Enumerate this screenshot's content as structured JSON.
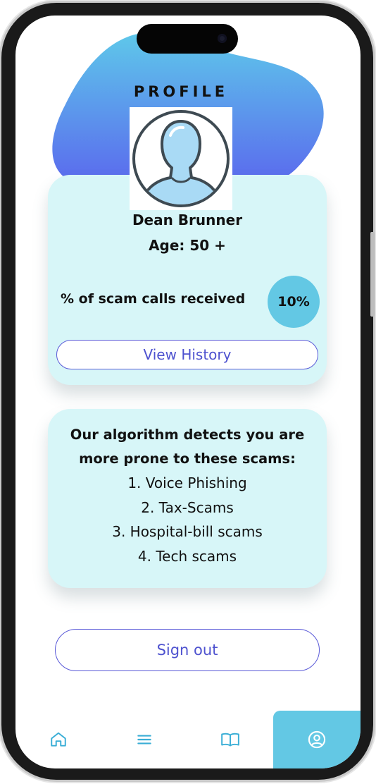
{
  "header": {
    "title": "PROFILE"
  },
  "profile": {
    "name": "Dean Brunner",
    "age": "Age: 50 +",
    "scam_calls_label": "% of scam calls received",
    "scam_calls_percent": "10%",
    "view_history_label": "View History"
  },
  "algorithm": {
    "heading_line1": "Our algorithm detects you are",
    "heading_line2": "more prone to these scams:",
    "scams": [
      "1. Voice Phishing",
      "2. Tax-Scams",
      "3. Hospital-bill scams",
      "4. Tech scams"
    ]
  },
  "actions": {
    "sign_out_label": "Sign out"
  },
  "bottom_nav": {
    "items": [
      {
        "icon": "home-icon"
      },
      {
        "icon": "menu-icon"
      },
      {
        "icon": "book-icon"
      },
      {
        "icon": "user-circle-icon",
        "active": true
      }
    ]
  },
  "colors": {
    "accent": "#63c8e4",
    "card_bg": "#d7f6f8",
    "button_text": "#4e52cf",
    "blob_top": "#5ec8ea",
    "blob_bottom": "#5a62ee"
  }
}
